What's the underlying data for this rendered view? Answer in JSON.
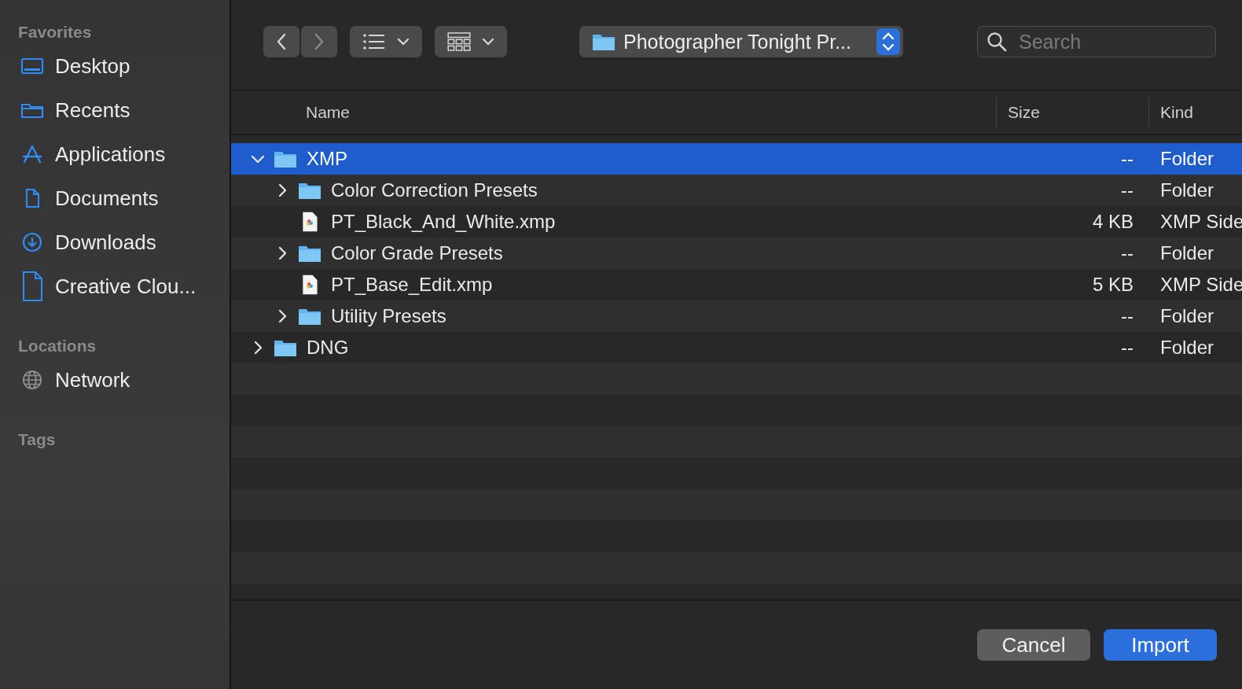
{
  "sidebar": {
    "sections": [
      {
        "heading": "Favorites",
        "items": [
          {
            "label": "Desktop",
            "kind": "desktop"
          },
          {
            "label": "Recents",
            "kind": "folder"
          },
          {
            "label": "Applications",
            "kind": "apps"
          },
          {
            "label": "Documents",
            "kind": "doc"
          },
          {
            "label": "Downloads",
            "kind": "download"
          },
          {
            "label": "Creative Clou...",
            "kind": "file"
          }
        ]
      },
      {
        "heading": "Locations",
        "items": [
          {
            "label": "Network",
            "kind": "globe"
          }
        ]
      },
      {
        "heading": "Tags"
      }
    ]
  },
  "toolbar": {
    "path": "Photographer Tonight Pr...",
    "search": {
      "placeholder": "Search"
    }
  },
  "table": {
    "columns": [
      "Name",
      "Size",
      "Kind"
    ],
    "rows": [
      {
        "name": "XMP",
        "size": "--",
        "kind_text": "Folder",
        "kind": "folder",
        "expanded": true,
        "selected": true,
        "children": [
          {
            "name": "Color Correction Presets",
            "size": "--",
            "kind_text": "Folder",
            "kind": "folder",
            "expanded": false,
            "selected": false
          },
          {
            "name": "PT_Black_And_White.xmp",
            "size": "4 KB",
            "kind_text": "XMP Side",
            "kind": "file",
            "selected": false
          },
          {
            "name": "Color Grade Presets",
            "size": "--",
            "kind_text": "Folder",
            "kind": "folder",
            "expanded": false,
            "selected": false
          },
          {
            "name": "PT_Base_Edit.xmp",
            "size": "5 KB",
            "kind_text": "XMP Side",
            "kind": "file",
            "selected": false
          },
          {
            "name": "Utility Presets",
            "size": "--",
            "kind_text": "Folder",
            "kind": "folder",
            "expanded": false,
            "selected": false
          }
        ]
      },
      {
        "name": "DNG",
        "size": "--",
        "kind_text": "Folder",
        "kind": "folder",
        "expanded": false,
        "selected": false
      }
    ]
  },
  "buttons": [
    {
      "label": "Cancel",
      "kind": "secondary"
    },
    {
      "label": "Import",
      "kind": "default"
    }
  ]
}
